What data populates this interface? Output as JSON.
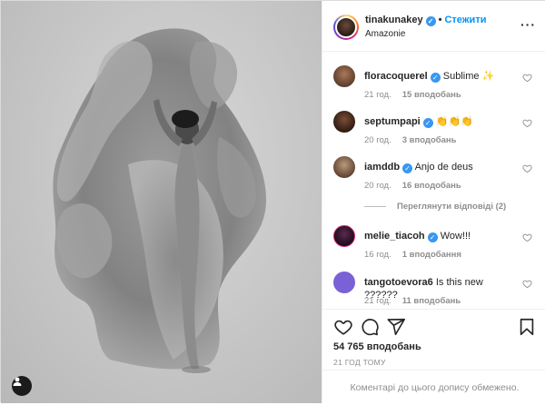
{
  "header": {
    "username": "tinakunakey",
    "follow_label": "Стежити",
    "separator": "•",
    "location": "Amazonie",
    "more_label": "···"
  },
  "comments": [
    {
      "username": "floracoquerel",
      "text": "Sublime ✨",
      "time": "21 год.",
      "likes": "15 вподобань",
      "verified": true
    },
    {
      "username": "septumpapi",
      "text": "👏👏👏",
      "time": "20 год.",
      "likes": "3 вподобань",
      "verified": true
    },
    {
      "username": "iamddb",
      "text": "Anjo de deus",
      "time": "20 год.",
      "likes": "16 вподобань",
      "verified": true
    },
    {
      "username": "melie_tiacoh",
      "text": "Wow!!!",
      "time": "16 год.",
      "likes": "1 вподобання",
      "verified": true
    },
    {
      "username": "tangotoevora6",
      "text": "Is this new ??????",
      "time": "21 год.",
      "likes": "11 вподобань",
      "verified": false
    }
  ],
  "view_replies": "Переглянути відповіді (2)",
  "post": {
    "likes": "54 765 вподобань",
    "time_ago": "21 ГОД ТОМУ",
    "comments_closed": "Коментарі до цього допису обмежено."
  },
  "icons": {
    "like": "heart-icon",
    "comment": "comment-icon",
    "share": "share-icon",
    "save": "bookmark-icon",
    "user_tag": "user-tag-icon"
  },
  "colors": {
    "accent": "#0095f6",
    "verified": "#3897f0",
    "muted": "#8e8e8e",
    "tangotoevora6_avatar": "#7b61d6"
  }
}
